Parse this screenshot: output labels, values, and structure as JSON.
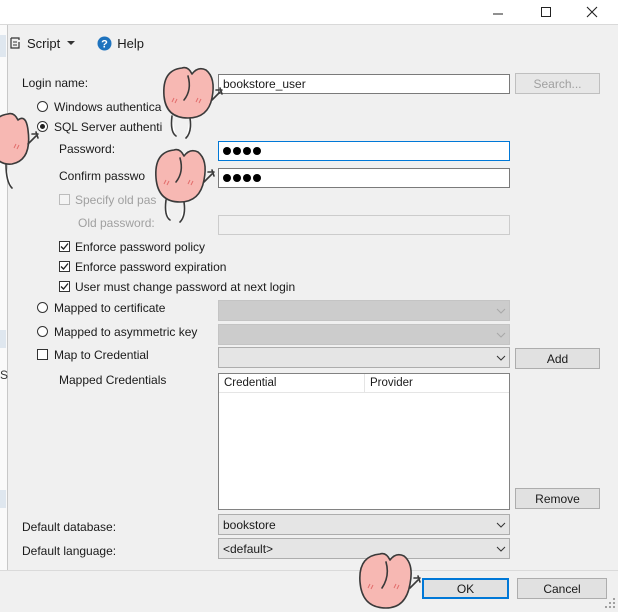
{
  "toolbar": {
    "script_label": "Script",
    "help_label": "Help"
  },
  "form": {
    "login_name_label": "Login name:",
    "login_name_value": "bookstore_user",
    "search_button": "Search...",
    "windows_auth_label": "Windows authentica",
    "sql_auth_label": "SQL Server authenti",
    "password_label": "Password:",
    "password_length": 4,
    "confirm_password_label": "Confirm passwo",
    "confirm_password_length": 4,
    "specify_old_password_label": "Specify old pas",
    "old_password_label": "Old password:",
    "enforce_policy_label": "Enforce password policy",
    "enforce_expiration_label": "Enforce password expiration",
    "must_change_label": "User must change password at next login",
    "mapped_cert_label": "Mapped to certificate",
    "mapped_asym_label": "Mapped to asymmetric key",
    "map_credential_label": "Map to Credential",
    "add_button": "Add",
    "mapped_credentials_label": "Mapped Credentials",
    "credential_col": "Credential",
    "provider_col": "Provider",
    "remove_button": "Remove",
    "default_database_label": "Default database:",
    "default_database_value": "bookstore",
    "default_language_label": "Default language:",
    "default_language_value": "<default>"
  },
  "buttons": {
    "ok": "OK",
    "cancel": "Cancel"
  },
  "edge_text": "S",
  "colors": {
    "focus": "#0078d7",
    "help_icon": "#1e73be",
    "sticker_pink": "#f7b8b3"
  }
}
